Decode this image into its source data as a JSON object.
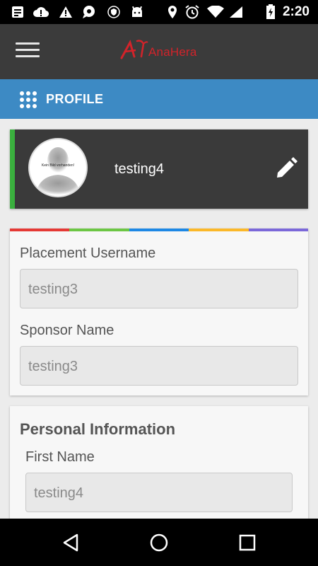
{
  "status_bar": {
    "time": "2:20",
    "icons": [
      "notification-icon",
      "cloud-alert-icon",
      "warning-icon",
      "chat-icon",
      "vpn-shield-icon",
      "android-icon",
      "location-icon",
      "alarm-icon",
      "wifi-icon",
      "signal-icon",
      "battery-charging-icon"
    ]
  },
  "app_bar": {
    "menu_icon": "hamburger-menu-icon",
    "logo_text": "AnaHera"
  },
  "section": {
    "icon": "grid-dots-icon",
    "title": "PROFILE"
  },
  "profile": {
    "avatar_text": "Kein Bild vorhanden!",
    "name": "testing4",
    "accent_color": "#3ab03e",
    "edit_icon": "pencil-icon"
  },
  "sponsor_card": {
    "strip_colors": [
      "#e53935",
      "#6cc644",
      "#1e88e5",
      "#fbb829",
      "#7b68d9"
    ],
    "fields": [
      {
        "label": "Placement Username",
        "value": "testing3"
      },
      {
        "label": "Sponsor Name",
        "value": "testing3"
      }
    ]
  },
  "personal_card": {
    "heading": "Personal Information",
    "fields": [
      {
        "label": "First Name",
        "value": "testing4"
      }
    ]
  },
  "nav_bar": {
    "buttons": [
      "back-icon",
      "home-icon",
      "recents-icon"
    ]
  }
}
